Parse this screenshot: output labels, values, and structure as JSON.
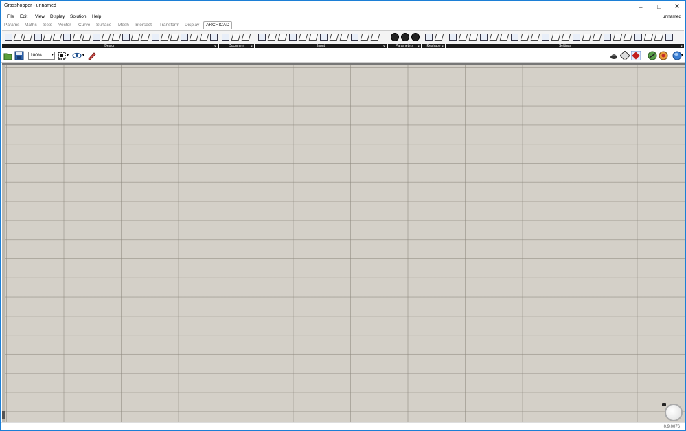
{
  "window": {
    "title": "Grasshopper - unnamed",
    "doc_name": "unnamed"
  },
  "menu": [
    "File",
    "Edit",
    "View",
    "Display",
    "Solution",
    "Help"
  ],
  "tabs": [
    "Params",
    "Maths",
    "Sets",
    "Vector",
    "Curve",
    "Surface",
    "Mesh",
    "Intersect",
    "Transform",
    "Display",
    "ARCHICAD"
  ],
  "active_tab": "ARCHICAD",
  "ribbon_panels": [
    {
      "label": "Design",
      "icon_count": 22
    },
    {
      "label": "Document",
      "icon_count": 3
    },
    {
      "label": "Input",
      "icon_count": 12
    },
    {
      "label": "Parameters",
      "icon_count": 3
    },
    {
      "label": "Reshape",
      "icon_count": 2
    },
    {
      "label": "Settings",
      "icon_count": 22
    }
  ],
  "toolbar": {
    "zoom_value": "100%",
    "left_icons": [
      "open-file-icon",
      "save-file-icon",
      "zoom-dropdown",
      "select-frame-icon",
      "preview-eye-icon",
      "sketch-pen-icon"
    ],
    "right_icons": [
      "preview-mesh-icon",
      "preview-wire-icon",
      "preview-shaded-icon",
      "preview-selected-icon",
      "preview-colour-icon",
      "display-mode-icon"
    ]
  },
  "status": {
    "left_marker": "_",
    "version": "0.9.0076"
  },
  "colors": {
    "canvas": "#d4d0c8",
    "grid": "#8c877d",
    "panel_label_bg": "#1a1a1a",
    "window_border": "#1c7fd6"
  }
}
